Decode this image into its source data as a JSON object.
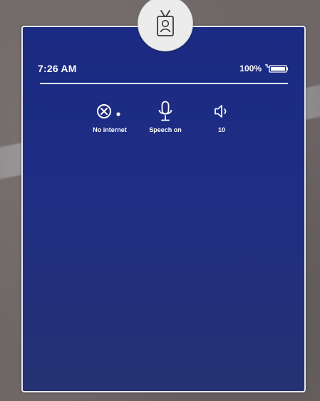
{
  "status_bar": {
    "time": "7:26 AM",
    "battery_percent": "100%"
  },
  "quick_status": [
    {
      "icon": "no-internet-icon",
      "label": "No internet"
    },
    {
      "icon": "microphone-icon",
      "label": "Speech on"
    },
    {
      "icon": "speaker-icon",
      "label": "10"
    }
  ],
  "badge_icon": "id-badge-icon",
  "colors": {
    "panel_background": "#1f2d84",
    "panel_border": "#e6e8f2",
    "text": "#ffffff",
    "badge_background": "#ececec"
  }
}
